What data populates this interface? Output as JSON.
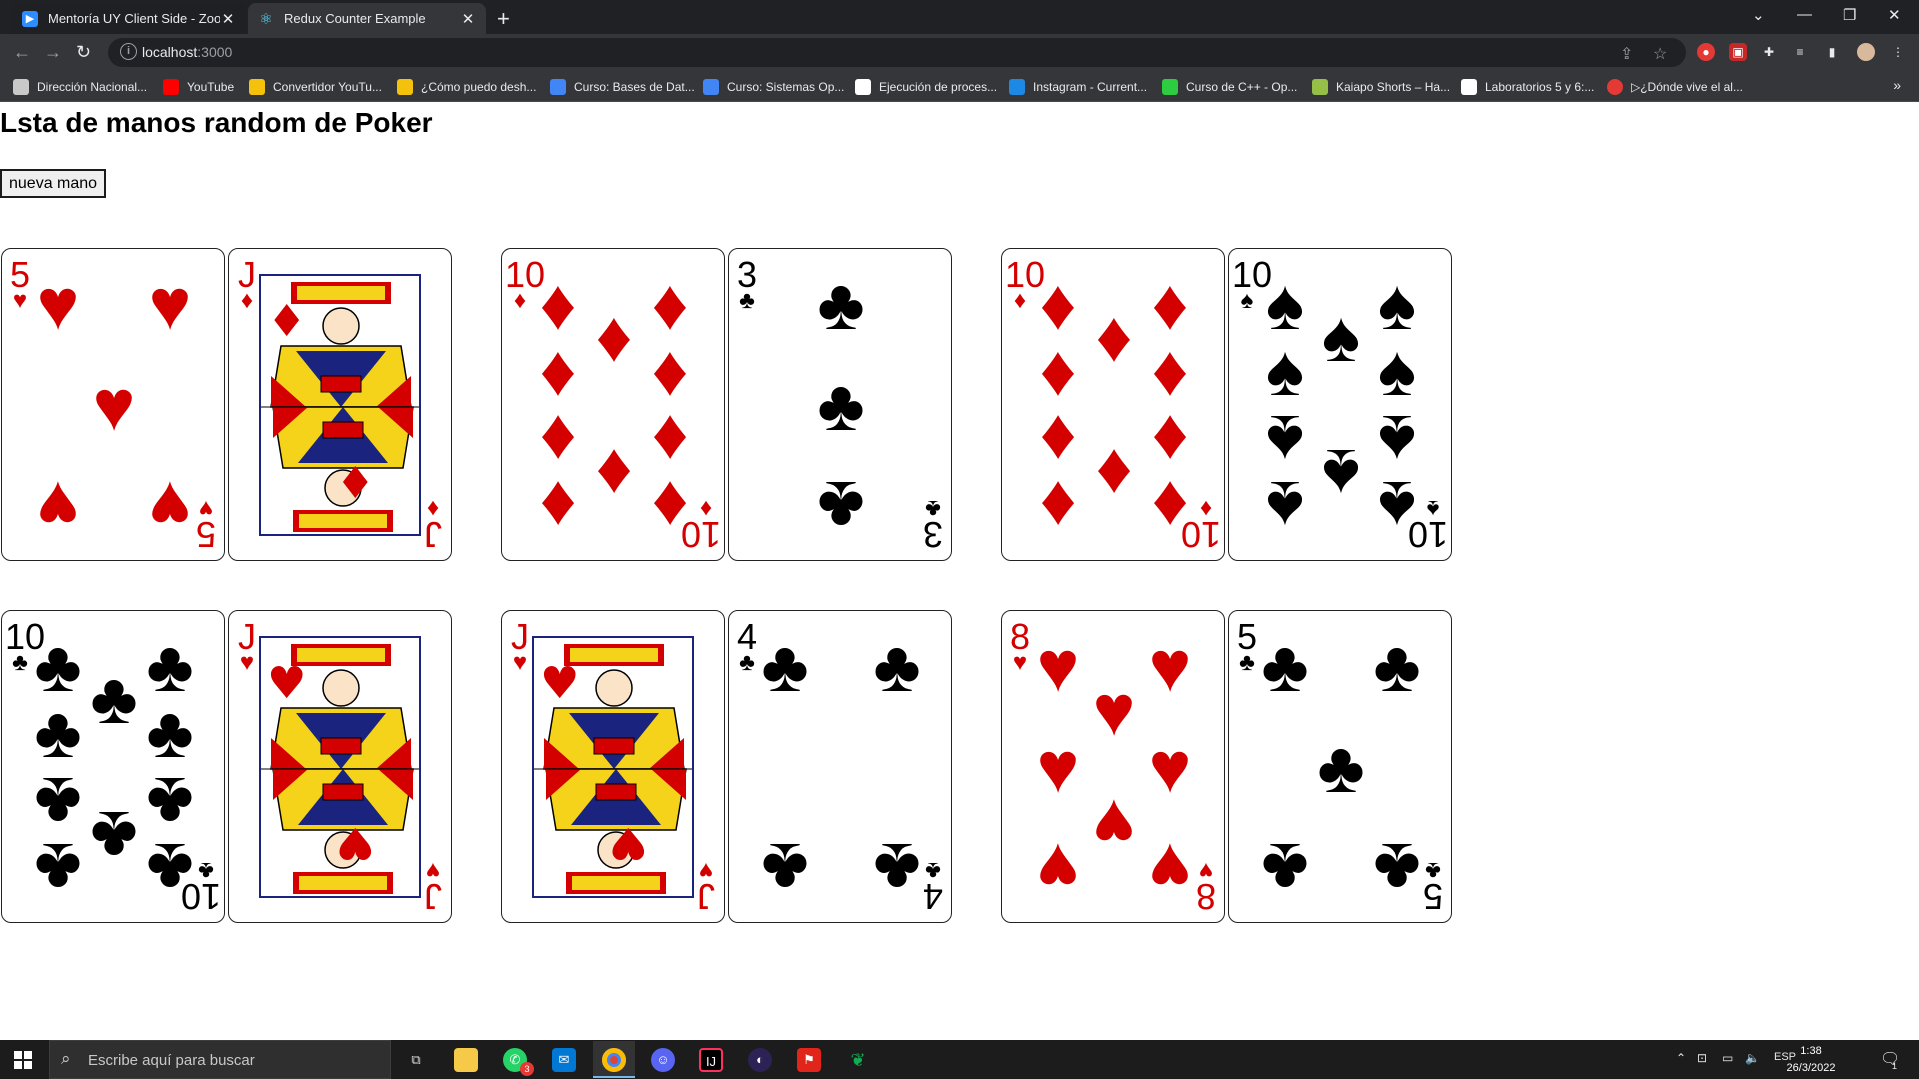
{
  "browser": {
    "tabs": [
      {
        "title": "Mentoría UY Client Side - Zoom",
        "icon": "zoom-icon",
        "active": false
      },
      {
        "title": "Redux Counter Example",
        "icon": "react-icon",
        "active": true
      }
    ],
    "address": {
      "host": "localhost",
      "port": ":3000"
    },
    "bookmarks": [
      {
        "label": "Dirección Nacional...",
        "color": "#c9c9c9"
      },
      {
        "label": "YouTube",
        "color": "#ff0000"
      },
      {
        "label": "Convertidor YouTu...",
        "color": "#f4c20d"
      },
      {
        "label": "¿Cómo puedo desh...",
        "color": "#f4c20d"
      },
      {
        "label": "Curso: Bases de Dat...",
        "color": "#4285f4"
      },
      {
        "label": "Curso: Sistemas Op...",
        "color": "#4285f4"
      },
      {
        "label": "Ejecución de proces...",
        "color": "#ffffff"
      },
      {
        "label": "Instagram - Current...",
        "color": "#1e88e5"
      },
      {
        "label": "Curso de C++ - Op...",
        "color": "#2ecc40"
      },
      {
        "label": "Kaiapo Shorts – Ha...",
        "color": "#95bf47"
      },
      {
        "label": "Laboratorios 5 y 6:...",
        "color": "#ffffff"
      },
      {
        "label": "▷¿Dónde vive el al...",
        "color": "#e53935"
      }
    ],
    "bookmarks_more": "»"
  },
  "page": {
    "heading": "Lsta de manos random de Poker",
    "button_label": "nueva mano",
    "hands": [
      [
        {
          "rank": "5",
          "suit": "♥"
        },
        {
          "rank": "J",
          "suit": "♦"
        }
      ],
      [
        {
          "rank": "10",
          "suit": "♦"
        },
        {
          "rank": "3",
          "suit": "♣"
        }
      ],
      [
        {
          "rank": "10",
          "suit": "♦"
        },
        {
          "rank": "10",
          "suit": "♠"
        }
      ],
      [
        {
          "rank": "10",
          "suit": "♣"
        },
        {
          "rank": "J",
          "suit": "♥"
        }
      ],
      [
        {
          "rank": "J",
          "suit": "♥"
        },
        {
          "rank": "4",
          "suit": "♣"
        }
      ],
      [
        {
          "rank": "8",
          "suit": "♥"
        },
        {
          "rank": "5",
          "suit": "♣"
        }
      ]
    ]
  },
  "taskbar": {
    "search_placeholder": "Escribe aquí para buscar",
    "apps": [
      {
        "name": "task-view-icon",
        "color": "#1c1c1c"
      },
      {
        "name": "file-explorer-icon",
        "color": "#f7c948"
      },
      {
        "name": "whatsapp-icon",
        "color": "#25d366"
      },
      {
        "name": "mail-icon",
        "color": "#0078d4"
      },
      {
        "name": "chrome-icon",
        "color": "#db4437"
      },
      {
        "name": "discord-icon",
        "color": "#5865f2"
      },
      {
        "name": "intellij-icon",
        "color": "#fe315d"
      },
      {
        "name": "eclipse-icon",
        "color": "#2c2255"
      },
      {
        "name": "acrobat-icon",
        "color": "#e1251b"
      },
      {
        "name": "mongodb-icon",
        "color": "#13aa52"
      }
    ],
    "whatsapp_badge": "3",
    "language": "ESP",
    "time": "1:38",
    "date": "26/3/2022",
    "notifications_badge": "1"
  },
  "colors": {
    "red_suit": "#d40000",
    "black_suit": "#000000",
    "chrome_dark": "#202124",
    "chrome_toolbar": "#35363a"
  }
}
